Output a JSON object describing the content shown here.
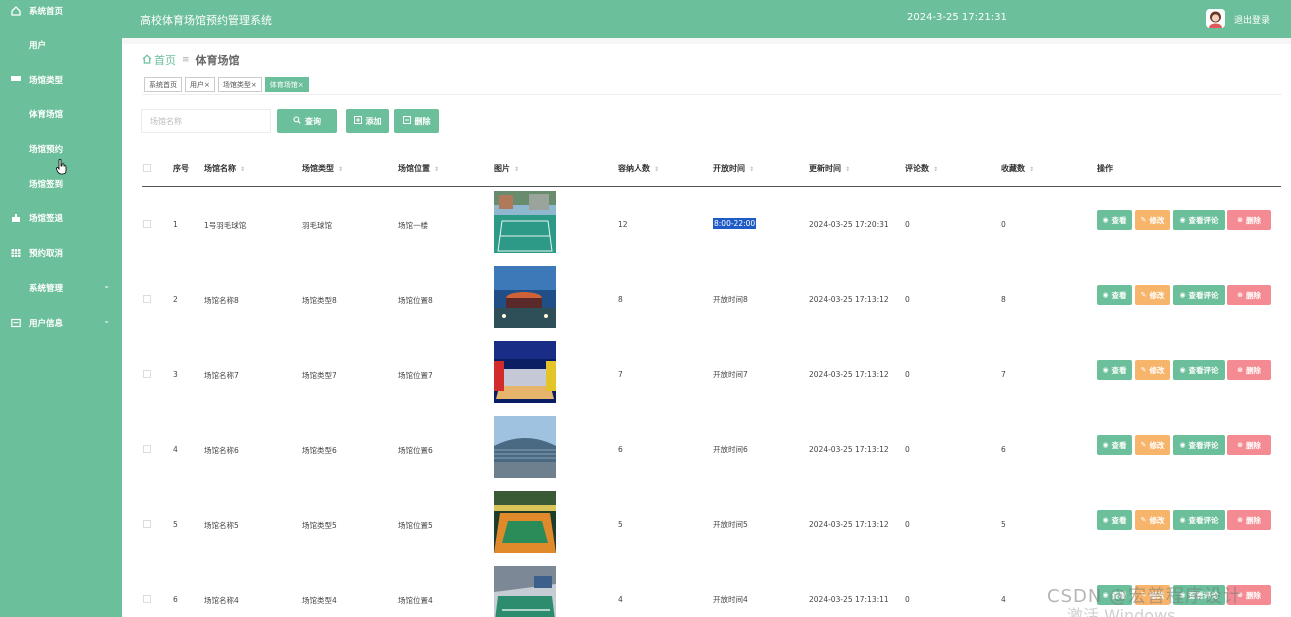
{
  "app": {
    "title": "高校体育场馆预约管理系统",
    "datetime": "2024-3-25 17:21:31",
    "logout": "退出登录"
  },
  "sidebar": {
    "items": [
      {
        "label": "系统首页",
        "icon": "home-icon"
      },
      {
        "label": "用户",
        "icon": "grid-icon"
      },
      {
        "label": "场馆类型",
        "icon": "list-icon"
      },
      {
        "label": "体育场馆",
        "icon": "grid-icon"
      },
      {
        "label": "场馆预约",
        "icon": "grid-icon"
      },
      {
        "label": "场馆签到",
        "icon": "grid-icon"
      },
      {
        "label": "场馆签退",
        "icon": "sign-out-icon"
      },
      {
        "label": "预约取消",
        "icon": "table-icon"
      },
      {
        "label": "系统管理",
        "icon": "grid-icon",
        "expand": "⌄"
      },
      {
        "label": "用户信息",
        "icon": "card-icon",
        "expand": "⌄"
      }
    ]
  },
  "breadcrumb": {
    "home": "首页",
    "sep": "≡",
    "current": "体育场馆"
  },
  "tags": [
    {
      "label": "系统首页"
    },
    {
      "label": "用户×"
    },
    {
      "label": "场馆类型×"
    },
    {
      "label": "体育场馆×",
      "active": true
    }
  ],
  "search": {
    "placeholder": "场馆名称"
  },
  "buttons": {
    "query": "查询",
    "add": "添加",
    "delete": "删除"
  },
  "table": {
    "columns": [
      "序号",
      "场馆名称",
      "场馆类型",
      "场馆位置",
      "图片",
      "容纳人数",
      "开放时间",
      "更新时间",
      "评论数",
      "收藏数",
      "操作"
    ],
    "row_actions": {
      "view": "查看",
      "edit": "修改",
      "comments": "查看评论",
      "delete": "删除"
    },
    "rows": [
      {
        "no": "1",
        "name": "1号羽毛球馆",
        "type": "羽毛球馆",
        "location": "场馆一楼",
        "capacity": "12",
        "open": "8:00-22:00",
        "updated": "2024-03-25 17:20:31",
        "comments": "0",
        "favorites": "0",
        "img": "outdoor-court"
      },
      {
        "no": "2",
        "name": "场馆名称8",
        "type": "场馆类型8",
        "location": "场馆位置8",
        "capacity": "8",
        "open": "开放时间8",
        "updated": "2024-03-25 17:13:12",
        "comments": "0",
        "favorites": "8",
        "img": "stadium-night"
      },
      {
        "no": "3",
        "name": "场馆名称7",
        "type": "场馆类型7",
        "location": "场馆位置7",
        "capacity": "7",
        "open": "开放时间7",
        "updated": "2024-03-25 17:13:12",
        "comments": "0",
        "favorites": "7",
        "img": "arena-interior"
      },
      {
        "no": "4",
        "name": "场馆名称6",
        "type": "场馆类型6",
        "location": "场馆位置6",
        "capacity": "6",
        "open": "开放时间6",
        "updated": "2024-03-25 17:13:12",
        "comments": "0",
        "favorites": "6",
        "img": "building-exterior"
      },
      {
        "no": "5",
        "name": "场馆名称5",
        "type": "场馆类型5",
        "location": "场馆位置5",
        "capacity": "5",
        "open": "开放时间5",
        "updated": "2024-03-25 17:13:12",
        "comments": "0",
        "favorites": "5",
        "img": "basketball-court"
      },
      {
        "no": "6",
        "name": "场馆名称4",
        "type": "场馆类型4",
        "location": "场馆位置4",
        "capacity": "4",
        "open": "开放时间4",
        "updated": "2024-03-25 17:13:11",
        "comments": "0",
        "favorites": "4",
        "img": "badminton-hall"
      }
    ]
  },
  "watermark": {
    "line1": "CSDN @宏普程序设计",
    "line2": "激活 Windows"
  },
  "colors": {
    "primary": "#6bbf9a",
    "edit": "#f7b56b",
    "delete": "#f48b92",
    "highlight": "#1e5bc6"
  }
}
